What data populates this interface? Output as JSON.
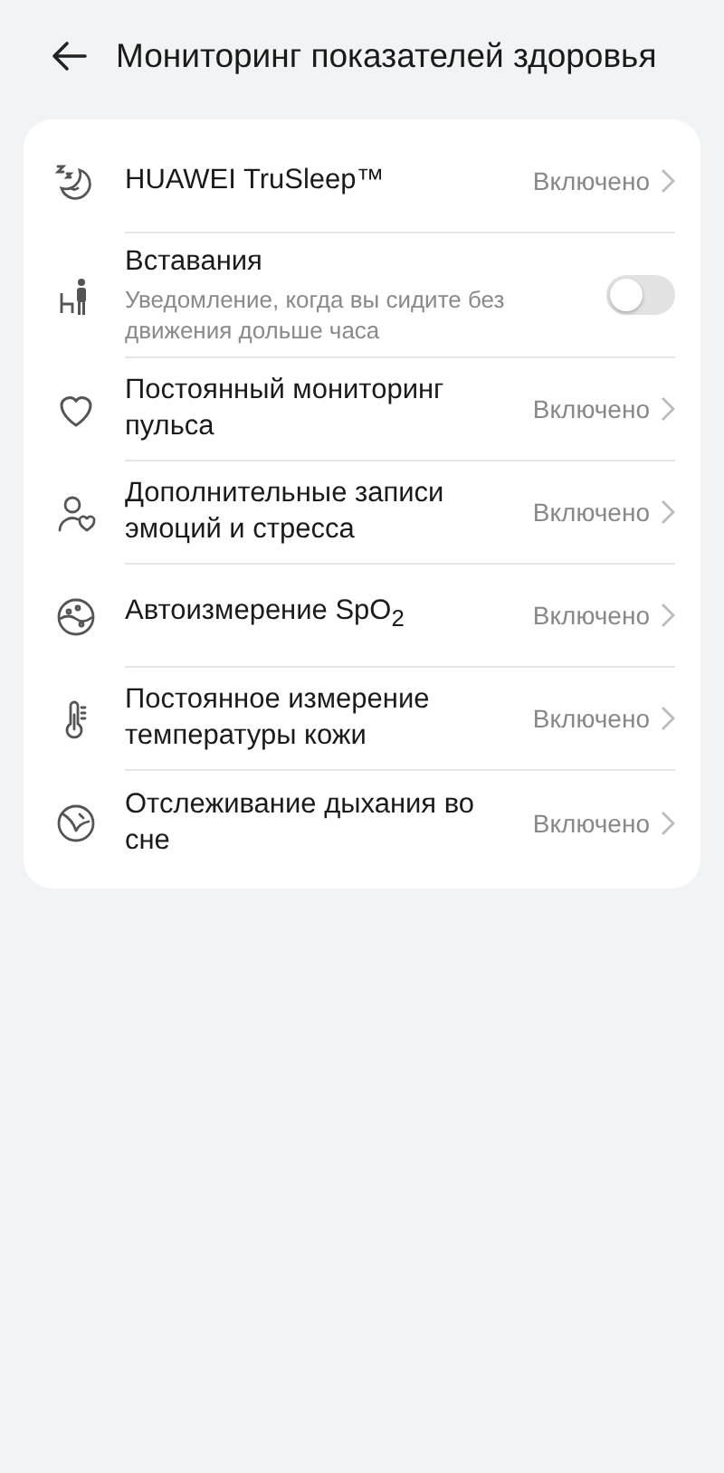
{
  "header": {
    "title": "Мониторинг показателей здоровья"
  },
  "settings": [
    {
      "kind": "link",
      "title": "HUAWEI TruSleep™",
      "value": "Включено"
    },
    {
      "kind": "toggle",
      "title": "Вставания",
      "subtitle": "Уведомление, когда вы сидите без движения дольше часа",
      "on": false
    },
    {
      "kind": "link",
      "title": "Постоянный мониторинг пульса",
      "value": "Включено"
    },
    {
      "kind": "link",
      "title": "Дополнительные записи эмоций и стресса",
      "value": "Включено"
    },
    {
      "kind": "link",
      "title": "Автоизмерение SpO$_{2}$",
      "value": "Включено"
    },
    {
      "kind": "link",
      "title": "Постоянное измерение температуры кожи",
      "value": "Включено"
    },
    {
      "kind": "link",
      "title": "Отслеживание дыхания во сне",
      "value": "Включено"
    }
  ]
}
